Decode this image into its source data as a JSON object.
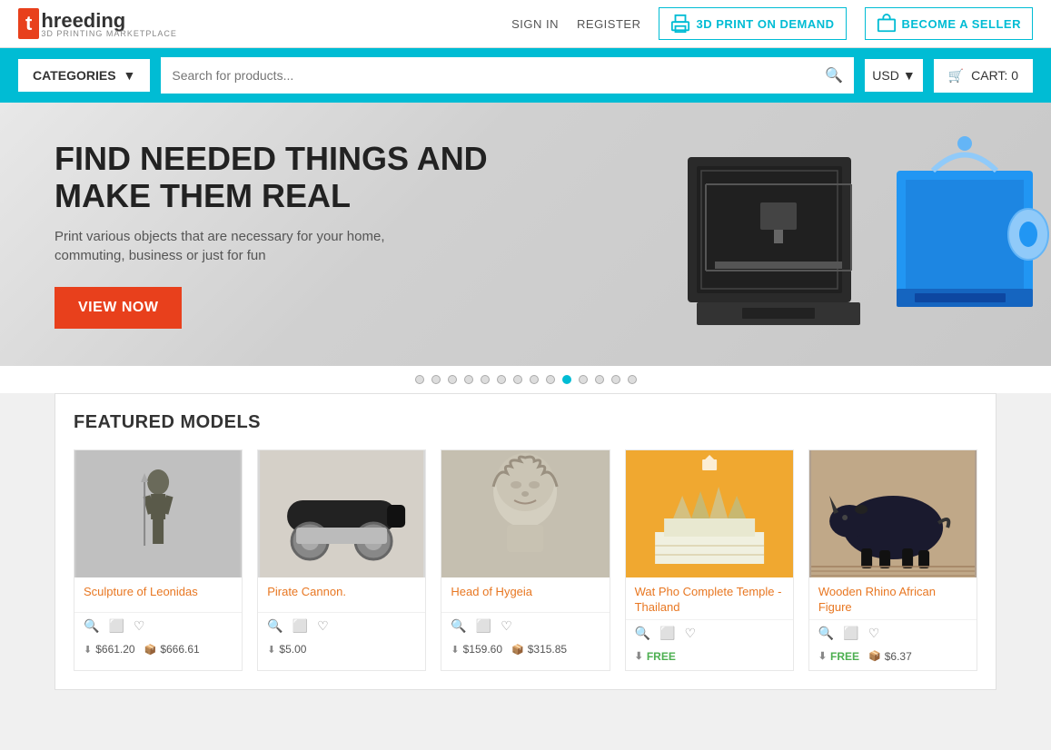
{
  "header": {
    "logo_letter": "t",
    "logo_name": "hreeding",
    "logo_sub": "3D PRINTING MARKETPLACE",
    "sign_in": "SIGN IN",
    "register": "REGISTER",
    "print_demand": "3D PRINT ON DEMAND",
    "become_seller": "BECOME A SELLER"
  },
  "toolbar": {
    "categories_label": "CATEGORIES",
    "search_placeholder": "Search for products...",
    "currency": "USD",
    "cart_label": "CART: 0"
  },
  "hero": {
    "title": "FIND NEEDED THINGS AND MAKE THEM REAL",
    "subtitle": "Print various objects that are necessary for your home, commuting, business or just for fun",
    "cta": "VIEW NOW"
  },
  "carousel": {
    "dots": 14,
    "active": 10
  },
  "featured": {
    "title": "FEATURED MODELS",
    "products": [
      {
        "name": "Sculpture of Leonidas",
        "download_price": "$661.20",
        "print_price": "$666.61",
        "img_type": "leonidas"
      },
      {
        "name": "Pirate Cannon.",
        "download_price": "$5.00",
        "print_price": "",
        "img_type": "cannon"
      },
      {
        "name": "Head of Hygeia",
        "download_price": "$159.60",
        "print_price": "$315.85",
        "img_type": "hygeia"
      },
      {
        "name": "Wat Pho Complete Temple - Thailand",
        "download_price": "FREE",
        "print_price": "",
        "img_type": "temple"
      },
      {
        "name": "Wooden Rhino African Figure",
        "download_price": "FREE",
        "print_price": "$6.37",
        "img_type": "rhino"
      }
    ]
  },
  "icons": {
    "search": "🔍",
    "cart": "🛒",
    "magnify": "🔍",
    "frame": "⬜",
    "heart": "♡",
    "download": "⬇",
    "print": "📦"
  }
}
